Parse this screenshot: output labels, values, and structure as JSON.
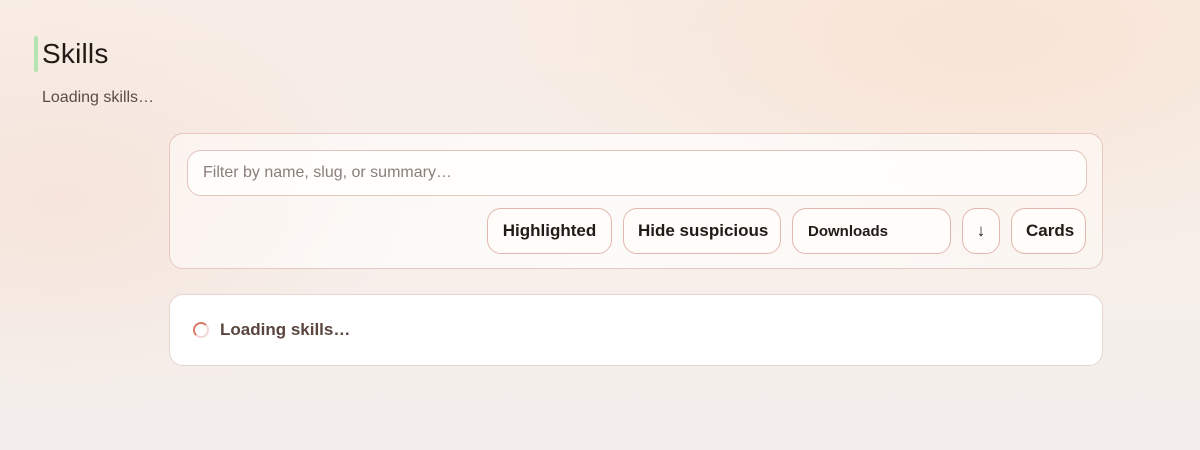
{
  "header": {
    "title": "Skills",
    "subtitle": "Loading skills…"
  },
  "toolbar": {
    "search": {
      "placeholder": "Filter by name, slug, or summary…",
      "value": ""
    },
    "buttons": {
      "highlighted": "Highlighted",
      "hide_suspicious": "Hide suspicious",
      "sort_direction": "↓",
      "view_mode": "Cards"
    },
    "sort": {
      "selected": "Downloads"
    }
  },
  "status": {
    "icon": "spinner-icon",
    "text": "Loading skills…"
  },
  "colors": {
    "title_accent": "#b5e4b2",
    "border": "#e2b8ae",
    "spinner": "#d97a68"
  }
}
